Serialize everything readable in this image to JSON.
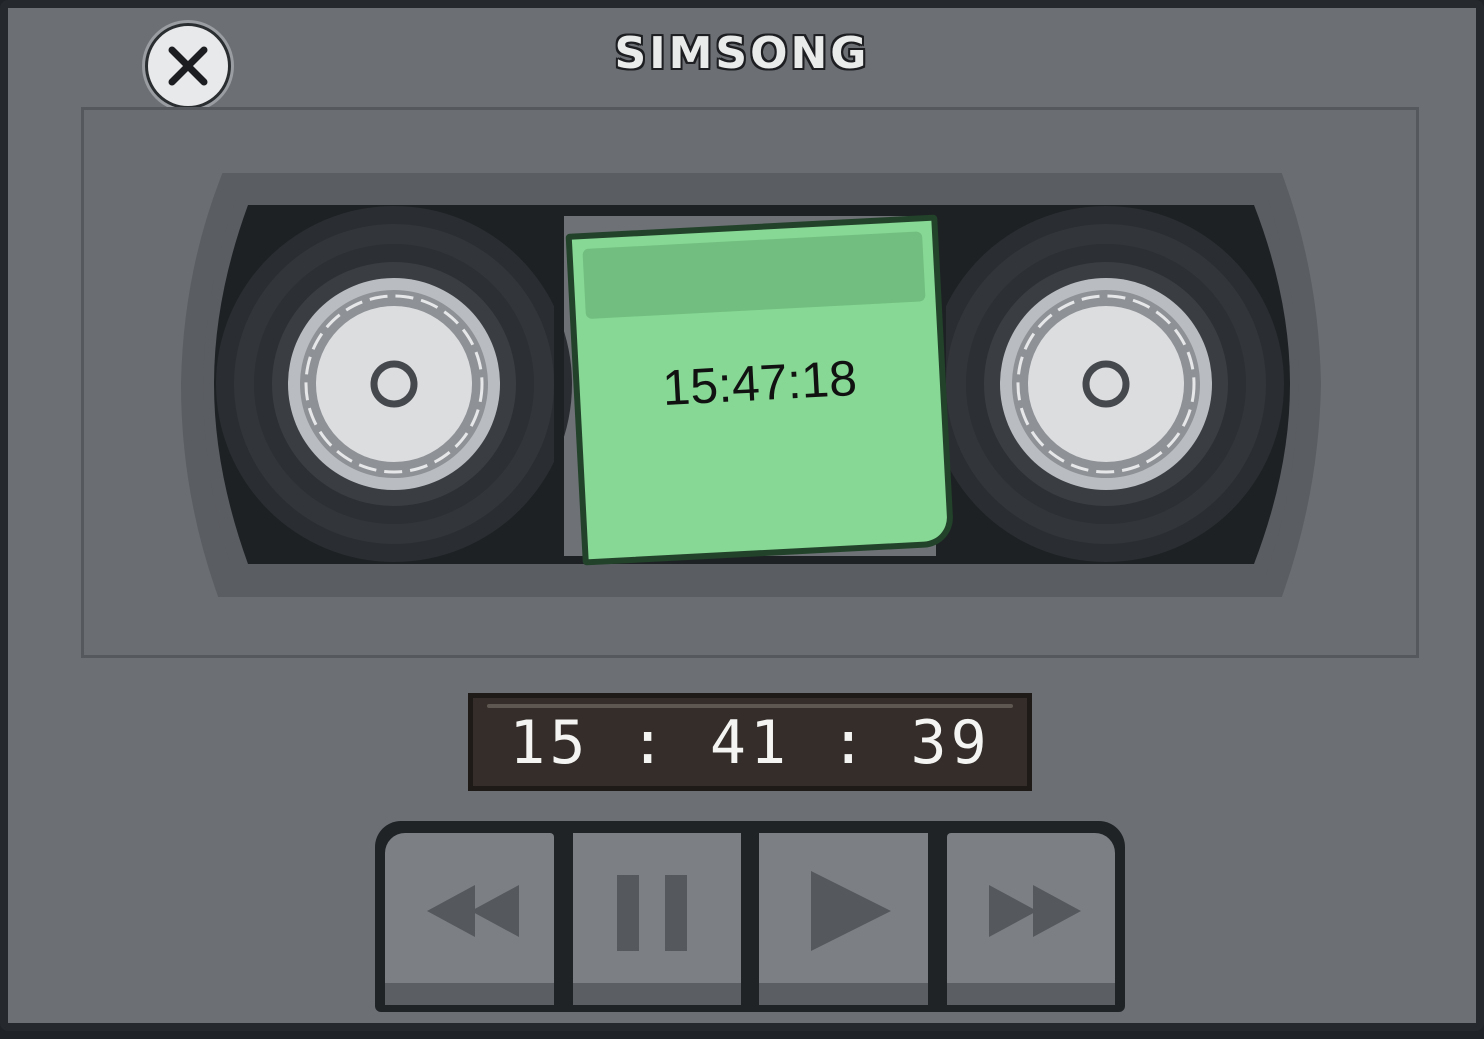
{
  "brand": "SIMSONG",
  "close_label": "close",
  "tape_label_time": "15:47:18",
  "counter_time": "15 : 41 : 39",
  "controls": [
    "rewind",
    "pause",
    "play",
    "fast-forward"
  ],
  "colors": {
    "body": "#6c6f74",
    "sticky_note": "#86d894",
    "counter_bg": "#342d29"
  }
}
